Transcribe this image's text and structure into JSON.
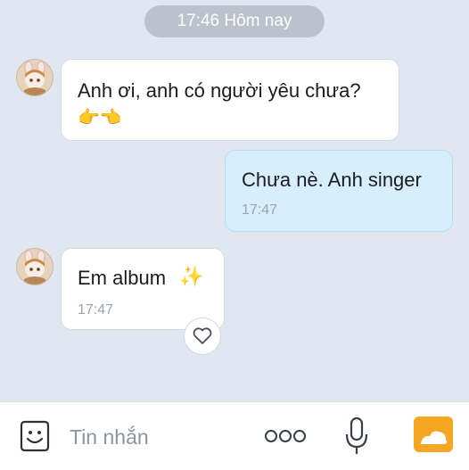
{
  "header": {
    "time_label": "17:46 Hôm nay"
  },
  "messages": [
    {
      "direction": "incoming",
      "text": "Anh ơi, anh có người yêu chưa?",
      "emoji": "👉👈"
    },
    {
      "direction": "outgoing",
      "text": "Chưa nè. Anh singer",
      "time": "17:47"
    },
    {
      "direction": "incoming",
      "text": "Em album",
      "emoji": "✨",
      "time": "17:47"
    }
  ],
  "input": {
    "placeholder": "Tin nhắn"
  },
  "icons": {
    "emoji_button": "smiley-icon",
    "more_button": "more-dots-icon",
    "voice_button": "microphone-icon",
    "photo_button": "photo-icon",
    "reaction_button": "heart-icon"
  },
  "colors": {
    "background": "#e1e7f0",
    "outgoing_bubble": "#d7eefe",
    "incoming_bubble": "#ffffff",
    "photo_icon": "#f5a623"
  }
}
